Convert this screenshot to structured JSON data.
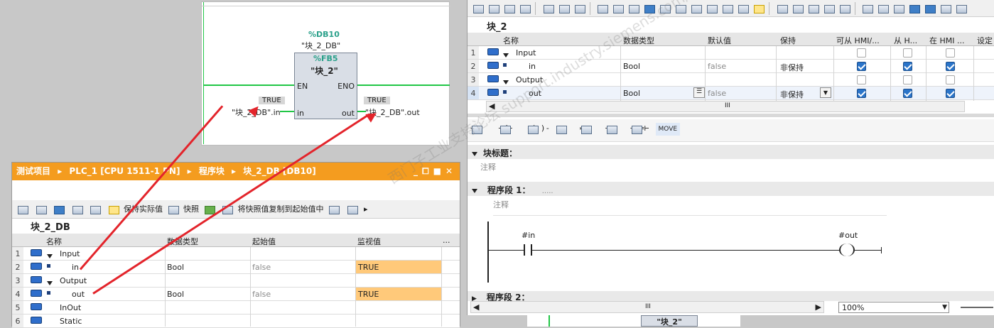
{
  "fb_diagram": {
    "instance_db_address": "%DB10",
    "instance_db_name": "\"块_2_DB\"",
    "fb_address": "%FB5",
    "fb_name": "\"块_2\"",
    "pin_en": "EN",
    "pin_eno": "ENO",
    "pin_in": "in",
    "pin_out": "out",
    "in_value": "TRUE",
    "out_value": "TRUE",
    "in_tag": "\"块_2_DB\".in",
    "out_tag": "\"块_2_DB\".out"
  },
  "db_window": {
    "title_parts": [
      "测试项目",
      "PLC_1 [CPU 1511-1 PN]",
      "程序块",
      "块_2_DB [DB10]"
    ],
    "window_buttons": [
      "_",
      "⧠",
      "■",
      "✕"
    ],
    "toolbar": {
      "keep_actual": "保持实际值",
      "snapshot": "快照",
      "copy_snapshot": "将快照值复制到起始值中"
    },
    "block_name": "块_2_DB",
    "columns": [
      "名称",
      "数据类型",
      "起始值",
      "监视值",
      "..."
    ],
    "rows": [
      {
        "n": "1",
        "name": "Input",
        "type": "",
        "start": "",
        "monitor": ""
      },
      {
        "n": "2",
        "name": "in",
        "type": "Bool",
        "start": "false",
        "monitor": "TRUE"
      },
      {
        "n": "3",
        "name": "Output",
        "type": "",
        "start": "",
        "monitor": ""
      },
      {
        "n": "4",
        "name": "out",
        "type": "Bool",
        "start": "false",
        "monitor": "TRUE"
      },
      {
        "n": "5",
        "name": "InOut",
        "type": "",
        "start": "",
        "monitor": ""
      },
      {
        "n": "6",
        "name": "Static",
        "type": "",
        "start": "",
        "monitor": ""
      }
    ]
  },
  "editor": {
    "block_name": "块_2",
    "columns": [
      "名称",
      "数据类型",
      "默认值",
      "保持",
      "可从 HMI/...",
      "从 H...",
      "在 HMI ...",
      "设定"
    ],
    "rows": [
      {
        "n": "1",
        "name": "Input",
        "type": "",
        "default": "",
        "retain": "",
        "c1": false,
        "c2": false,
        "c3": false
      },
      {
        "n": "2",
        "name": "in",
        "type": "Bool",
        "default": "false",
        "retain": "非保持",
        "c1": true,
        "c2": true,
        "c3": true
      },
      {
        "n": "3",
        "name": "Output",
        "type": "",
        "default": "",
        "retain": "",
        "c1": false,
        "c2": false,
        "c3": false
      },
      {
        "n": "4",
        "name": "out",
        "type": "Bool",
        "default": "false",
        "retain": "非保持",
        "c1": true,
        "c2": true,
        "c3": true
      }
    ],
    "scroll_mid": "III",
    "lad_move": "MOVE",
    "block_title_label": "块标题：",
    "comment": "注释",
    "network1_label": "程序段 1：",
    "network1_dots": ".....",
    "network1_comment": "注释",
    "contact_tag": "#in",
    "coil_tag": "#out",
    "network2_label": "程序段 2：",
    "zoom": "100%",
    "bottom_preview": "\"块_2\""
  },
  "watermark": "西门子工业支持论坛 support.industry.siemens.com/cs",
  "colors": {
    "accent_orange": "#f49c1f",
    "wire_green": "#21c646",
    "highlight": "#ffc97a",
    "arrow_red": "#e3242b"
  }
}
